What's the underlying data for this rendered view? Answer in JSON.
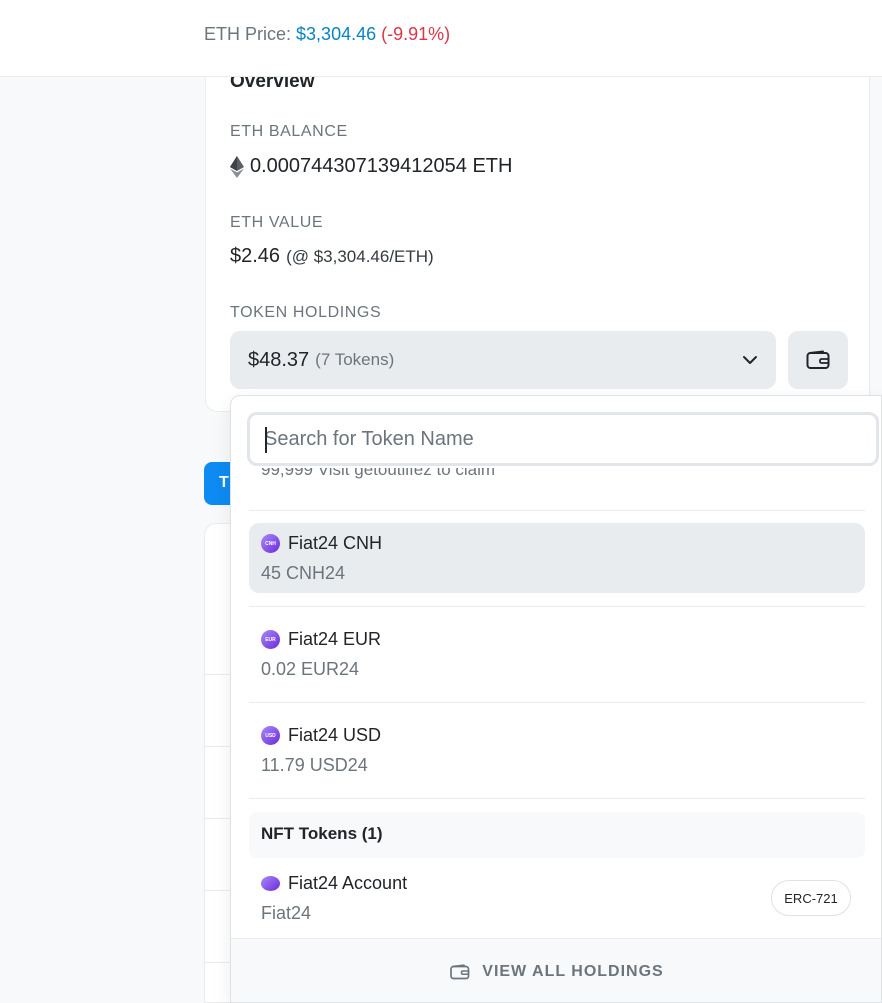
{
  "header": {
    "price_label": "ETH Price:",
    "price_value": "$3,304.46",
    "price_change": "(-9.91%)"
  },
  "overview": {
    "title": "Overview",
    "eth_balance_label": "ETH BALANCE",
    "eth_balance_value": "0.000744307139412054 ETH",
    "eth_value_label": "ETH VALUE",
    "eth_value": "$2.46",
    "eth_value_rate": "(@ $3,304.46/ETH)",
    "token_holdings_label": "TOKEN HOLDINGS",
    "token_holdings_value": "$48.37",
    "token_holdings_count": "(7 Tokens)"
  },
  "background": {
    "tab_label": "T"
  },
  "dropdown": {
    "search_placeholder": "Search for Token Name",
    "clipped_text": "99,999 Visit getoutlifez to claim",
    "tokens": [
      {
        "name": "Fiat24 CNH",
        "amount": "45 CNH24",
        "icon_text": "CNH"
      },
      {
        "name": "Fiat24 EUR",
        "amount": "0.02 EUR24",
        "icon_text": "EUR"
      },
      {
        "name": "Fiat24 USD",
        "amount": "11.79 USD24",
        "icon_text": "USD"
      }
    ],
    "nft_section_label": "NFT Tokens (1)",
    "nft": {
      "name": "Fiat24 Account",
      "amount": "Fiat24",
      "badge": "ERC-721"
    },
    "footer_label": "VIEW ALL HOLDINGS"
  },
  "colors": {
    "link_blue": "#0784c3",
    "negative_red": "#dc3545",
    "primary_tab": "#0d8bf2"
  }
}
